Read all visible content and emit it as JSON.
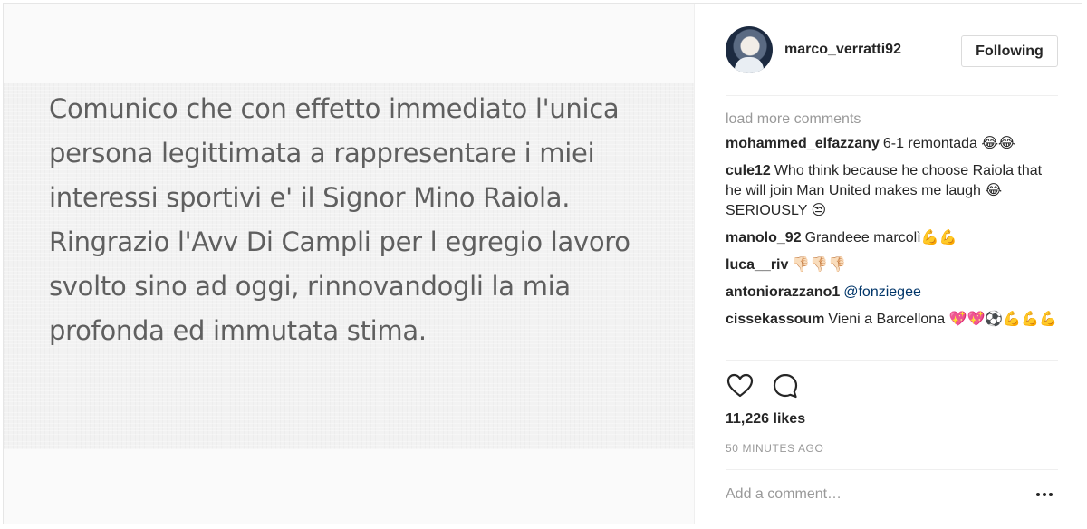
{
  "post": {
    "text": "Comunico che con effetto immediato l'unica persona legittimata a rappresentare i miei interessi sportivi e' il Signor Mino Raiola. Ringrazio l'Avv Di Campli per l egregio lavoro svolto sino ad oggi, rinnovandogli la mia profonda ed immutata stima."
  },
  "header": {
    "username": "marco_verratti92",
    "follow_label": "Following"
  },
  "comments": {
    "load_more": "load more comments",
    "items": [
      {
        "user": "mohammed_elfazzany",
        "text": "6-1 remontada 😂😂"
      },
      {
        "user": "cule12",
        "text": "Who think because he choose Raiola that he will join Man United makes me laugh 😂 SERIOUSLY 😒"
      },
      {
        "user": "manolo_92",
        "text": "Grandeee marcolì💪💪"
      },
      {
        "user": "luca__riv",
        "text": "👎🏻👎🏻👎🏻"
      },
      {
        "user": "antoniorazzano1",
        "mention": "@fonziegee"
      },
      {
        "user": "cissekassoum",
        "text": "Vieni a Barcellona 💖💖⚽💪💪💪"
      }
    ]
  },
  "actions": {
    "like_icon": "heart-icon",
    "comment_icon": "comment-bubble-icon"
  },
  "likes": "11,226 likes",
  "timestamp": "50 MINUTES AGO",
  "add_comment": {
    "placeholder": "Add a comment…",
    "more_icon": "more-options-icon"
  }
}
